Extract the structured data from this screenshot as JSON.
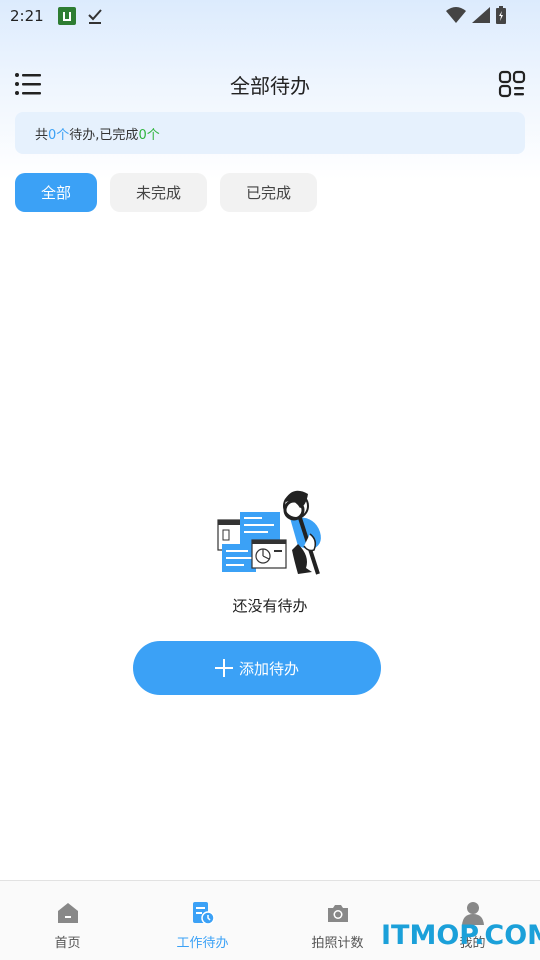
{
  "status_bar": {
    "time": "2:21"
  },
  "header": {
    "title": "全部待办"
  },
  "summary": {
    "prefix": "共",
    "total": "0个",
    "middle": "待办,已完成",
    "done": "0个"
  },
  "tabs": [
    {
      "label": "全部",
      "active": true
    },
    {
      "label": "未完成",
      "active": false
    },
    {
      "label": "已完成",
      "active": false
    }
  ],
  "empty": {
    "message": "还没有待办",
    "add_label": "添加待办"
  },
  "bottom_nav": [
    {
      "label": "首页",
      "icon": "home-icon"
    },
    {
      "label": "工作待办",
      "icon": "todo-icon",
      "active": true
    },
    {
      "label": "拍照计数",
      "icon": "camera-icon"
    },
    {
      "label": "我的",
      "icon": "user-icon"
    }
  ],
  "watermark": "ITMOP.COM",
  "colors": {
    "accent": "#3ba1f6",
    "done_green": "#2fb43d"
  }
}
